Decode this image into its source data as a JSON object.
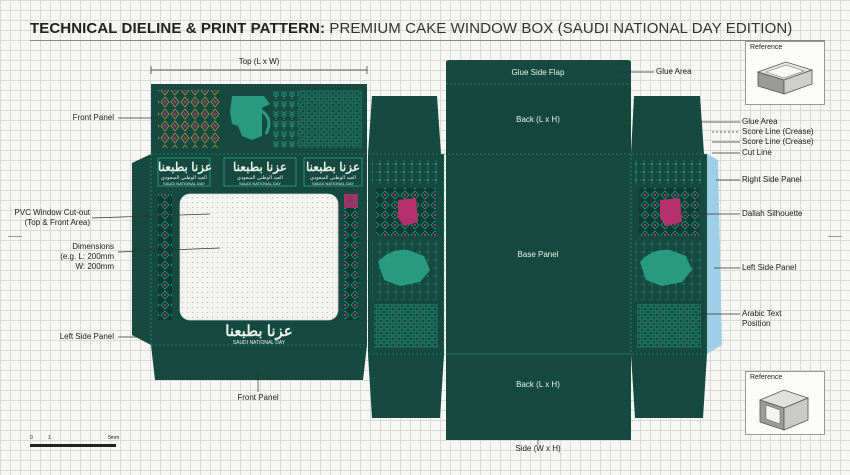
{
  "header": {
    "title_bold": "TECHNICAL DIELINE & PRINT PATTERN:",
    "title_rest": "PREMIUM CAKE WINDOW BOX (SAUDI NATIONAL DAY EDITION)"
  },
  "labels": {
    "top": "Top (L x W)",
    "front_panel_upper": "Front Panel",
    "pvc_window": "PVC Window Cut-out\n(Top & Front Area)",
    "dimensions": "Dimensions\n(e.g. L: 200mm\nW: 200mm",
    "left_side_panel": "Left Side Panel",
    "front_panel_lower": "Front Panel",
    "glue_side_flap": "Glue Side Flap",
    "glue_area_1": "Glue Area",
    "back_upper": "Back (L x H)",
    "glue_area_2": "Glue Area",
    "score_line_1": "Score Line (Crease)",
    "score_line_2": "Score Line (Crease)",
    "cut_line": "Cut Line",
    "right_side_panel": "Right Side Panel",
    "dallah": "Dallah Silhouette",
    "base_panel": "Base Panel",
    "left_side_panel_right": "Left Side Panel",
    "arabic_text": "Arabic Text\nPosition",
    "back_lower": "Back (L x H)",
    "side_bottom": "Side (W x H)"
  },
  "artwork": {
    "arabic_logo": "عزنا بطبعنا",
    "arabic_sub": "العيد الوطني السعودي",
    "national_day": "SAUDI NATIONAL DAY"
  },
  "reference": {
    "title_top": "Reference",
    "title_bottom": "Reference"
  },
  "scale": {
    "start": "0",
    "mid": "1",
    "end": "5mm"
  },
  "colors": {
    "panel": "#16493f",
    "panel_dark": "#0f3a31",
    "teal": "#2aa88c",
    "magenta": "#b5316e",
    "gold": "#c9a442",
    "glue": "#9ecfe6",
    "window": "#f2f2f0"
  }
}
